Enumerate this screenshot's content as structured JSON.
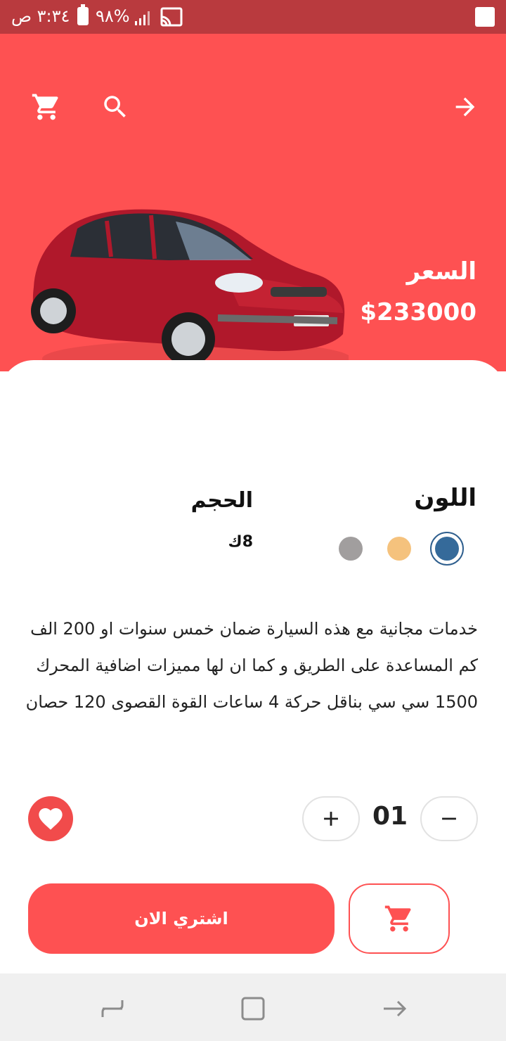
{
  "status_bar": {
    "time": "٣:٣٤ ص",
    "battery": "%٩٨"
  },
  "toolbar": {
    "cart_icon": "cart-icon",
    "search_icon": "search-icon",
    "back_icon": "arrow-right-icon"
  },
  "product": {
    "image": "red-car-photo",
    "price_label": "السعر",
    "price": "$233000"
  },
  "options": {
    "color_label": "اللون",
    "colors": [
      "#356a9a",
      "#f5c27d",
      "#a19e9e"
    ],
    "selected_color": "#356a9a",
    "size_label": "الحجم",
    "size_value": "8ك"
  },
  "description": "خدمات مجانية مع هذه السيارة ضمان خمس سنوات او 200 الف كم المساعدة على الطريق و كما ان لها مميزات اضافية المحرك 1500 سي سي بناقل حركة 4 ساعات القوة القصوى 120 حصان",
  "quantity": {
    "value": "01",
    "plus_icon": "plus-icon",
    "minus_icon": "minus-icon"
  },
  "actions": {
    "buy_now_label": "اشتري الان",
    "add_to_cart_icon": "cart-icon",
    "favorite_icon": "heart-icon"
  },
  "nav_bar": {
    "recent_icon": "recent-apps-icon",
    "home_icon": "home-icon",
    "back_icon": "back-icon"
  },
  "colors": {
    "accent": "#fe5152",
    "status_bar": "#b93a3e"
  }
}
